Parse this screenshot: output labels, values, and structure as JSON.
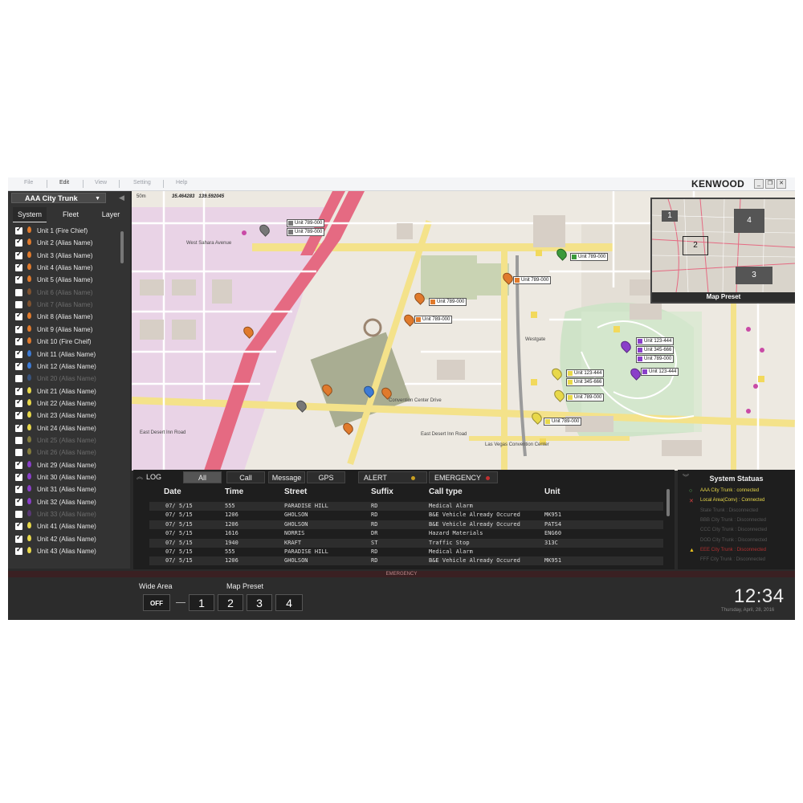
{
  "menu": {
    "file": "File",
    "edit": "Edit",
    "view": "View",
    "setting": "Setting",
    "help": "Help"
  },
  "brand": "KENWOOD",
  "window": {
    "minimize": "_",
    "restore": "❐",
    "close": "✕"
  },
  "sidebar": {
    "trunk": "AAA City Trunk",
    "tabs": [
      "System",
      "Fleet",
      "Layer"
    ],
    "units": [
      {
        "label": "Unit 1 (Fire Chief)",
        "checked": true,
        "color": "#e07a2c"
      },
      {
        "label": "Unit 2 (Alias Name)",
        "checked": true,
        "color": "#e07a2c"
      },
      {
        "label": "Unit 3 (Alias Name)",
        "checked": true,
        "color": "#e07a2c"
      },
      {
        "label": "Unit 4 (Alias Name)",
        "checked": true,
        "color": "#e07a2c"
      },
      {
        "label": "Unit 5 (Alias Name)",
        "checked": true,
        "color": "#e07a2c"
      },
      {
        "label": "Unit 6 (Alias Name)",
        "checked": false,
        "color": "#e07a2c"
      },
      {
        "label": "Unit 7 (Alias Name)",
        "checked": false,
        "color": "#e07a2c"
      },
      {
        "label": "Unit 8 (Alias Name)",
        "checked": true,
        "color": "#e07a2c"
      },
      {
        "label": "Unit 9 (Alias Name)",
        "checked": true,
        "color": "#e07a2c"
      },
      {
        "label": "Unit 10 (Fire Cheif)",
        "checked": true,
        "color": "#e07a2c"
      },
      {
        "label": "Unit 11 (Alias Name)",
        "checked": true,
        "color": "#3d7bd6"
      },
      {
        "label": "Unit 12 (Alias Name)",
        "checked": true,
        "color": "#3d7bd6"
      },
      {
        "label": "Unit 20 (Alias Name)",
        "checked": false,
        "color": "#3d7bd6"
      },
      {
        "label": "Unit 21 (Alias Name)",
        "checked": true,
        "color": "#e8d84a"
      },
      {
        "label": "Unit 22 (Alias Name)",
        "checked": true,
        "color": "#e8d84a"
      },
      {
        "label": "Unit 23 (Alias Name)",
        "checked": true,
        "color": "#e8d84a"
      },
      {
        "label": "Unit 24 (Alias Name)",
        "checked": true,
        "color": "#e8d84a"
      },
      {
        "label": "Unit 25 (Alias Name)",
        "checked": false,
        "color": "#e8d84a"
      },
      {
        "label": "Unit 26 (Alias Name)",
        "checked": false,
        "color": "#e8d84a"
      },
      {
        "label": "Unit 29 (Alias Name)",
        "checked": true,
        "color": "#8a3fc9"
      },
      {
        "label": "Unit 30 (Alias Name)",
        "checked": true,
        "color": "#8a3fc9"
      },
      {
        "label": "Unit 31 (Alias Name)",
        "checked": true,
        "color": "#8a3fc9"
      },
      {
        "label": "Unit 32 (Alias Name)",
        "checked": true,
        "color": "#8a3fc9"
      },
      {
        "label": "Unit 33 (Alias Name)",
        "checked": false,
        "color": "#8a3fc9"
      },
      {
        "label": "Unit 41 (Alias Name)",
        "checked": true,
        "color": "#e8d84a"
      },
      {
        "label": "Unit 42 (Alias Name)",
        "checked": true,
        "color": "#e8d84a"
      },
      {
        "label": "Unit 43 (Alias Name)",
        "checked": true,
        "color": "#e8d84a"
      }
    ]
  },
  "map": {
    "scale": "50m",
    "lat": "35.464283",
    "lon": "139.592045",
    "streets": {
      "a": "West Sahara Avenue",
      "b": "East Desert Inn Road",
      "c": "Convention Center Drive",
      "d": "Las Vegas Convention Center",
      "e": "East Desert Inn Road",
      "f": "Westgate"
    },
    "tags": [
      {
        "text": "Unit 789-000",
        "color": "#777777"
      },
      {
        "text": "Unit 789-000",
        "color": "#777777"
      },
      {
        "text": "Unit 789-000",
        "color": "#3b9a3b"
      },
      {
        "text": "Unit 789-000",
        "color": "#e07a2c"
      },
      {
        "text": "Unit 789-000",
        "color": "#e07a2c"
      },
      {
        "text": "Unit 789-000",
        "color": "#e07a2c"
      },
      {
        "text": "Unit 123-444",
        "color": "#8a3fc9"
      },
      {
        "text": "Unit 345-666",
        "color": "#8a3fc9"
      },
      {
        "text": "Unit 789-000",
        "color": "#8a3fc9"
      },
      {
        "text": "Unit 123-444",
        "color": "#8a3fc9"
      },
      {
        "text": "Unit 123-444",
        "color": "#e8d84a"
      },
      {
        "text": "Unit 345-666",
        "color": "#e8d84a"
      },
      {
        "text": "Unit 789-000",
        "color": "#e8d84a"
      },
      {
        "text": "Unit 789-000",
        "color": "#e8d84a"
      }
    ],
    "minimap": {
      "n1": "1",
      "n2": "2",
      "n3": "3",
      "n4": "4",
      "footer": "Map Preset"
    }
  },
  "log": {
    "tabs": {
      "log": "LOG",
      "all": "All",
      "call": "Call",
      "message": "Message",
      "gps": "GPS",
      "alert": "ALERT",
      "emergency": "EMERGENCY"
    },
    "columns": {
      "date": "Date",
      "time": "Time",
      "street": "Street",
      "suffix": "Suffix",
      "calltype": "Call type",
      "unit": "Unit"
    },
    "rows": [
      {
        "date": "07/ 5/15",
        "time": "555",
        "street": "PARADISE HILL",
        "suffix": "RD",
        "calltype": "Medical Alarm",
        "unit": ""
      },
      {
        "date": "07/ 5/15",
        "time": "1206",
        "street": "GHOLSON",
        "suffix": "RD",
        "calltype": "B&E Vehicle Already Occured",
        "unit": "MK951"
      },
      {
        "date": "07/ 5/15",
        "time": "1206",
        "street": "GHOLSON",
        "suffix": "RD",
        "calltype": "B&E Vehicle Already Occured",
        "unit": "PATS4"
      },
      {
        "date": "07/ 5/15",
        "time": "1616",
        "street": "NORRIS",
        "suffix": "DR",
        "calltype": "Hazard Materials",
        "unit": "ENG60"
      },
      {
        "date": "07/ 5/15",
        "time": "1940",
        "street": "KRAFT",
        "suffix": "ST",
        "calltype": "Traffic Stop",
        "unit": "313C"
      },
      {
        "date": "07/ 5/15",
        "time": "555",
        "street": "PARADISE HILL",
        "suffix": "RD",
        "calltype": "Medical Alarm",
        "unit": ""
      },
      {
        "date": "07/ 5/15",
        "time": "1206",
        "street": "GHOLSON",
        "suffix": "RD",
        "calltype": "B&E Vehicle Already Occured",
        "unit": "MK951"
      }
    ]
  },
  "status": {
    "title": "System Statuas",
    "items": [
      {
        "text": "AAA City Trunk : connected",
        "color": "#e8d84a",
        "icon": "○",
        "icon_color": "#5fbf5f"
      },
      {
        "text": "Local Area(Conv) : Connected",
        "color": "#e8d84a",
        "icon": "✕",
        "icon_color": "#d94040"
      },
      {
        "text": "State Trunk : Disconnected",
        "color": "#555555",
        "icon": "",
        "icon_color": "#555555"
      },
      {
        "text": "BBB City Trunk : Disconnected",
        "color": "#555555",
        "icon": "",
        "icon_color": "#555555"
      },
      {
        "text": "CCC City Trunk : Disconnected",
        "color": "#555555",
        "icon": "",
        "icon_color": "#555555"
      },
      {
        "text": "DOD City Trunk : Disconnected",
        "color": "#555555",
        "icon": "",
        "icon_color": "#555555"
      },
      {
        "text": "EEE City Trunk : Disconnected",
        "color": "#b03030",
        "icon": "▲",
        "icon_color": "#e8c020"
      },
      {
        "text": "FFF City Trunk : Disconnected",
        "color": "#555555",
        "icon": "",
        "icon_color": "#555555"
      }
    ]
  },
  "emergency_bar": "EMERGENCY",
  "bottom": {
    "wide_area": "Wide Area",
    "off": "OFF",
    "map_preset": "Map Preset",
    "presets": [
      "1",
      "2",
      "3",
      "4"
    ],
    "clock": "12:34",
    "date": "Thursday, April, 28, 2016"
  }
}
